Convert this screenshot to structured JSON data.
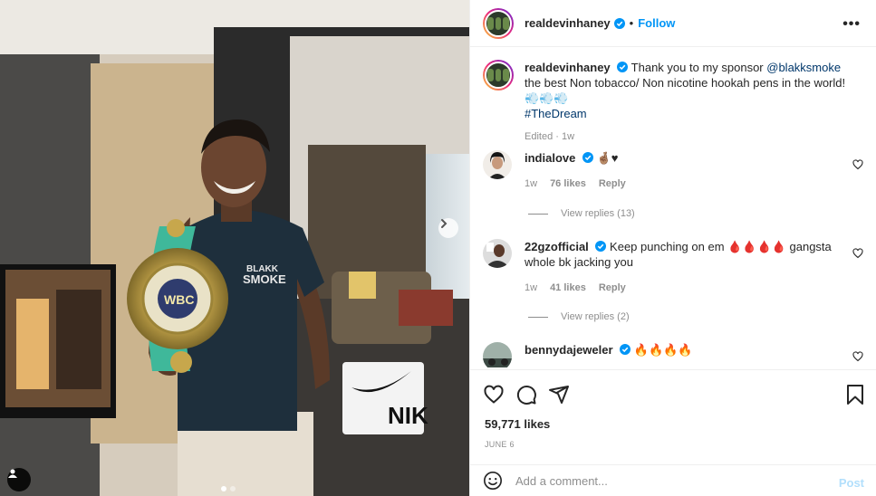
{
  "post": {
    "author": "realdevinhaney",
    "follow_label": "Follow",
    "separator": "•",
    "more_label": "•••",
    "caption": {
      "text": "Thank you to my sponsor ",
      "mention": "@blakksmoke",
      "text_after": " the best Non tobacco/ Non nicotine hookah pens in the world! 💨💨💨",
      "hashtag": "#TheDream",
      "meta": "Edited · 1w"
    },
    "photo": {
      "shirt_text_line1": "BLAKK",
      "shirt_text_line2": "SMOKE",
      "belt_text": "WBC",
      "bag_text": "NIK"
    },
    "likes": "59,771 likes",
    "date": "JUNE 6",
    "carousel_dots": 2
  },
  "comments": [
    {
      "username": "indialove",
      "text": "🤞🏽♥",
      "time": "1w",
      "likes": "76 likes",
      "reply_label": "Reply",
      "view_replies": "View replies (13)"
    },
    {
      "username": "22gzofficial",
      "text": "Keep punching on em 🩸🩸🩸🩸 gangsta whole bk jacking you",
      "time": "1w",
      "likes": "41 likes",
      "reply_label": "Reply",
      "view_replies": "View replies (2)"
    },
    {
      "username": "bennydajeweler",
      "text": "🔥🔥🔥🔥"
    }
  ],
  "composer": {
    "placeholder": "Add a comment...",
    "post_label": "Post"
  },
  "colors": {
    "link_blue": "#0095f6",
    "mention_blue": "#00376b",
    "muted": "#8e8e8e",
    "belt_green": "#3fb89a"
  }
}
